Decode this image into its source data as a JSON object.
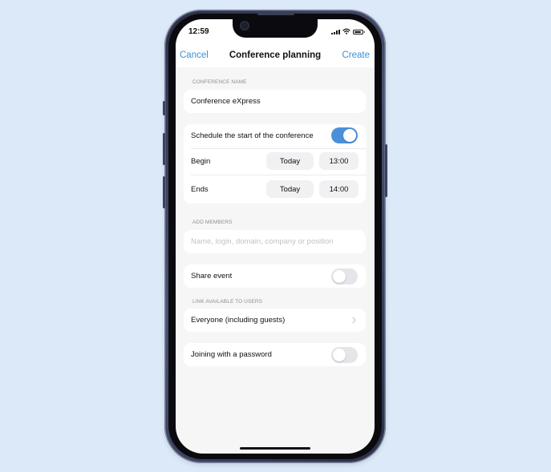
{
  "status_bar": {
    "time": "12:59"
  },
  "nav": {
    "cancel_label": "Cancel",
    "title": "Conference planning",
    "create_label": "Create"
  },
  "conference_name": {
    "section_label": "CONFERENCE NAME",
    "value": "Conference eXpress"
  },
  "schedule": {
    "toggle_label": "Schedule the start of the conference",
    "toggle_on": true,
    "begin": {
      "label": "Begin",
      "date": "Today",
      "time": "13:00"
    },
    "ends": {
      "label": "Ends",
      "date": "Today",
      "time": "14:00"
    }
  },
  "add_members": {
    "section_label": "ADD MEMBERS",
    "placeholder": "Name, login, domain, company or position"
  },
  "share_event": {
    "label": "Share event",
    "toggle_on": false
  },
  "link_access": {
    "section_label": "LINK AVAILABLE TO USERS",
    "value": "Everyone (including guests)"
  },
  "password": {
    "label": "Joining with a password",
    "toggle_on": false
  },
  "colors": {
    "accent": "#3a8fd9",
    "toggle_on": "#4a90d9",
    "background": "#dce9f8",
    "screen_bg": "#f6f6f6"
  }
}
